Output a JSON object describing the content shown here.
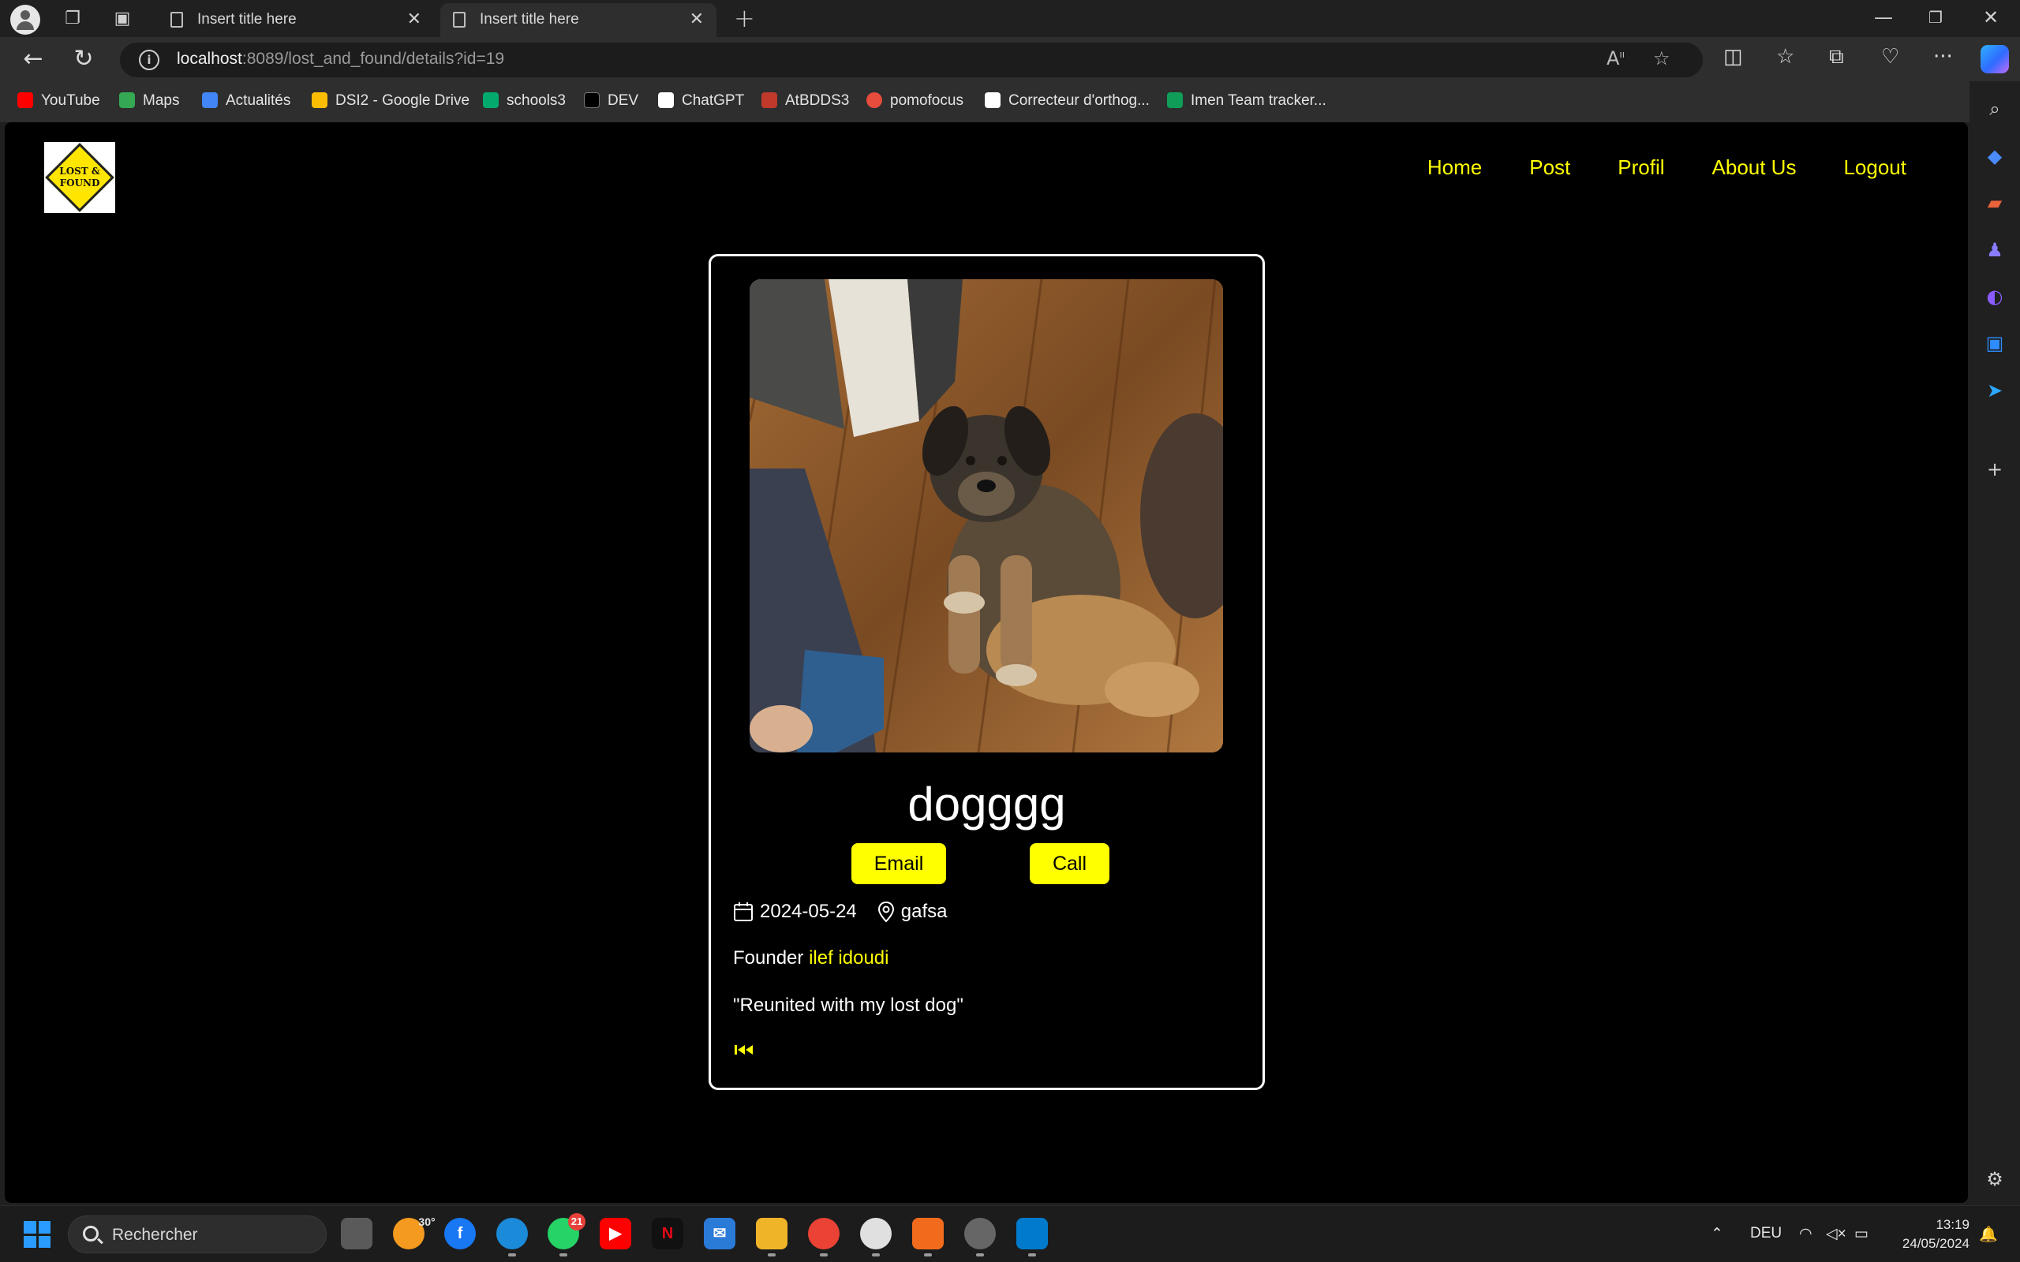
{
  "browser": {
    "tabs": [
      {
        "title": "Insert title here"
      },
      {
        "title": "Insert title here"
      }
    ],
    "url_host": "localhost",
    "url_path": ":8089/lost_and_found/details?id=19",
    "bookmarks": [
      {
        "label": "YouTube",
        "icon": "youtube-icon",
        "color": "#ff0000"
      },
      {
        "label": "Maps",
        "icon": "maps-icon",
        "color": "#34a853"
      },
      {
        "label": "Actualités",
        "icon": "news-icon",
        "color": "#4285f4"
      },
      {
        "label": "DSI2 - Google Drive",
        "icon": "drive-icon",
        "color": "#fbbc04"
      },
      {
        "label": "schools3",
        "icon": "w3schools-icon",
        "color": "#04aa6d"
      },
      {
        "label": "DEV",
        "icon": "dev-icon",
        "color": "#000000"
      },
      {
        "label": "ChatGPT",
        "icon": "chatgpt-icon",
        "color": "#ffffff"
      },
      {
        "label": "AtBDDS3",
        "icon": "atbdds-icon",
        "color": "#c0392b"
      },
      {
        "label": "pomofocus",
        "icon": "pomofocus-icon",
        "color": "#e74c3c"
      },
      {
        "label": "Correcteur d'orthog...",
        "icon": "correcteur-icon",
        "color": "#ffffff"
      },
      {
        "label": "Imen Team tracker...",
        "icon": "sheets-icon",
        "color": "#0f9d58"
      }
    ]
  },
  "site": {
    "logo_text": "LOST & FOUND",
    "nav": [
      "Home",
      "Post",
      "Profil",
      "About Us",
      "Logout"
    ]
  },
  "post": {
    "title": "dogggg",
    "email_label": "Email",
    "call_label": "Call",
    "date": "2024-05-24",
    "location": "gafsa",
    "founder_label": "Founder",
    "founder_name": "ilef idoudi",
    "quote": "\"Reunited with my lost dog\"",
    "accent": "#ffff00"
  },
  "taskbar": {
    "search_placeholder": "Rechercher",
    "weather": "30°",
    "whatsapp_badge": "21",
    "language": "DEU",
    "time": "13:19",
    "date": "24/05/2024"
  }
}
